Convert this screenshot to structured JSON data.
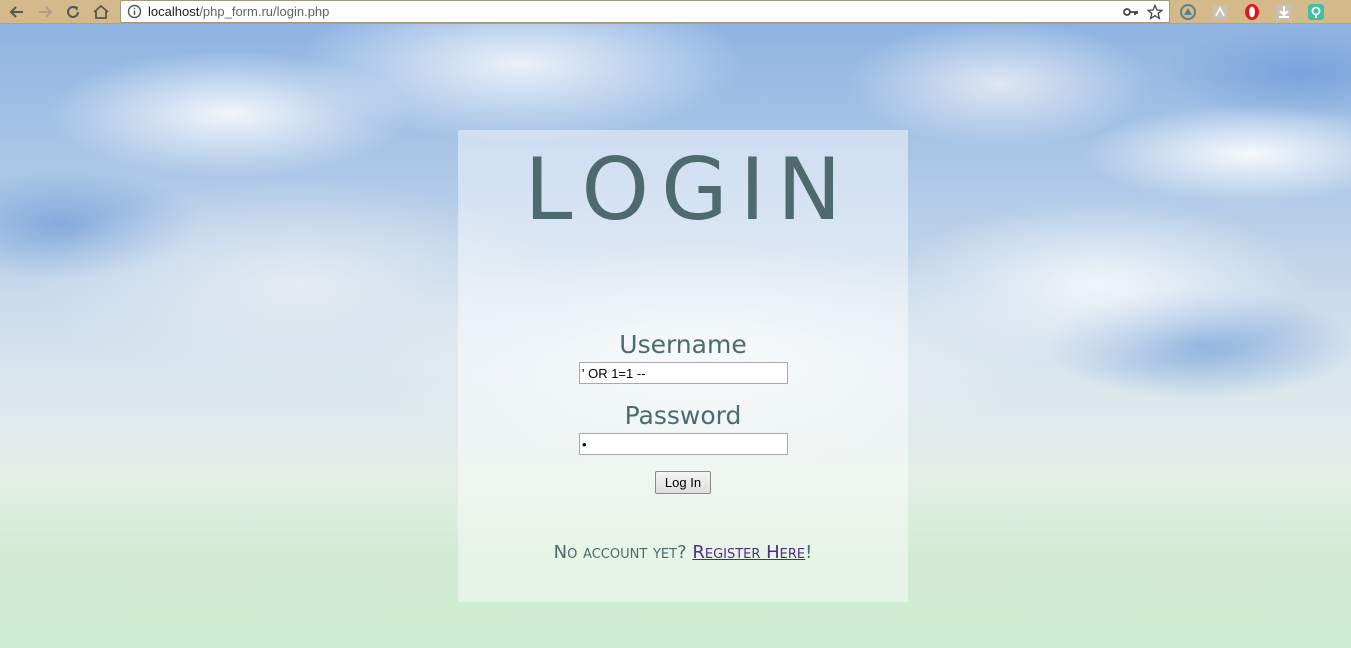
{
  "browser": {
    "url_host": "localhost",
    "url_path": "/php_form.ru/login.php",
    "toolbar_color": "#d4b98a",
    "icons": {
      "back": "arrow-left-icon",
      "forward": "arrow-right-icon",
      "reload": "reload-icon",
      "home": "home-icon",
      "site_info": "info-icon",
      "key": "key-icon",
      "bookmark": "star-icon",
      "extensions": [
        "vpn-extension-icon",
        "pdf-extension-icon",
        "opera-extension-icon",
        "download-extension-icon",
        "map-extension-icon"
      ]
    }
  },
  "login": {
    "title": "LOGIN",
    "username_label": "Username",
    "username_value": "' OR 1=1 --",
    "password_label": "Password",
    "password_value": "•",
    "button_label": "Log In",
    "register_prompt": "No account yet? ",
    "register_link": "Register Here",
    "register_suffix": "!",
    "text_color": "#4d6a6e",
    "link_color": "#4a2f86"
  }
}
